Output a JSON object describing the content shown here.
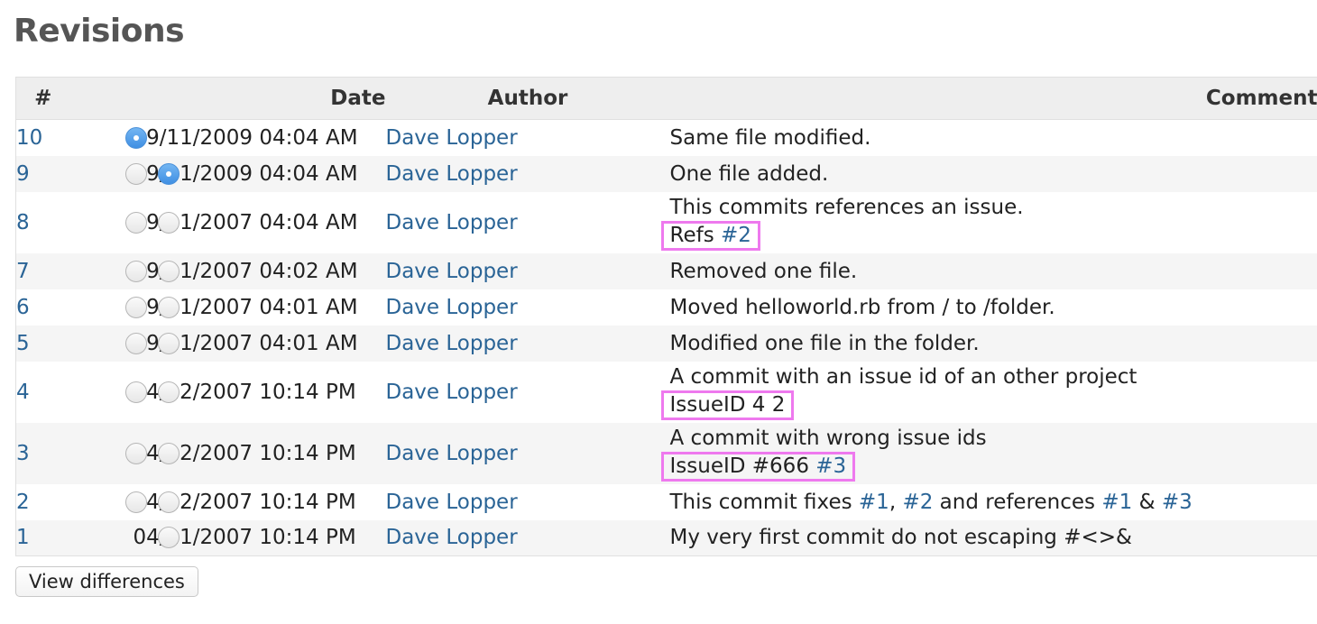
{
  "page": {
    "title": "Revisions"
  },
  "table": {
    "headers": {
      "num": "#",
      "date": "Date",
      "author": "Author",
      "comment": "Comment"
    },
    "rows": [
      {
        "rev": "10",
        "radio1": "checked",
        "radio2": "none",
        "date": "09/11/2009 04:04 AM",
        "author": "Dave Lopper",
        "comment": [
          {
            "t": "Same file modified."
          }
        ],
        "extra": null
      },
      {
        "rev": "9",
        "radio1": "unchecked",
        "radio2": "checked",
        "date": "09/11/2009 04:04 AM",
        "author": "Dave Lopper",
        "comment": [
          {
            "t": "One file added."
          }
        ],
        "extra": null
      },
      {
        "rev": "8",
        "radio1": "unchecked",
        "radio2": "unchecked",
        "date": "09/11/2007 04:04 AM",
        "author": "Dave Lopper",
        "comment": [
          {
            "t": "This commits references an issue."
          }
        ],
        "extra": [
          {
            "t": "Refs "
          },
          {
            "link": "#2"
          }
        ]
      },
      {
        "rev": "7",
        "radio1": "unchecked",
        "radio2": "unchecked",
        "date": "09/11/2007 04:02 AM",
        "author": "Dave Lopper",
        "comment": [
          {
            "t": "Removed one file."
          }
        ],
        "extra": null
      },
      {
        "rev": "6",
        "radio1": "unchecked",
        "radio2": "unchecked",
        "date": "09/11/2007 04:01 AM",
        "author": "Dave Lopper",
        "comment": [
          {
            "t": "Moved helloworld.rb from / to /folder."
          }
        ],
        "extra": null
      },
      {
        "rev": "5",
        "radio1": "unchecked",
        "radio2": "unchecked",
        "date": "09/11/2007 04:01 AM",
        "author": "Dave Lopper",
        "comment": [
          {
            "t": "Modified one file in the folder."
          }
        ],
        "extra": null
      },
      {
        "rev": "4",
        "radio1": "unchecked",
        "radio2": "unchecked",
        "date": "04/12/2007 10:14 PM",
        "author": "Dave Lopper",
        "comment": [
          {
            "t": "A commit with an issue id of an other project"
          }
        ],
        "extra": [
          {
            "t": "IssueID 4 2"
          }
        ]
      },
      {
        "rev": "3",
        "radio1": "unchecked",
        "radio2": "unchecked",
        "date": "04/12/2007 10:14 PM",
        "author": "Dave Lopper",
        "comment": [
          {
            "t": "A commit with wrong issue ids"
          }
        ],
        "extra": [
          {
            "t": "IssueID #666 "
          },
          {
            "link": "#3"
          }
        ]
      },
      {
        "rev": "2",
        "radio1": "unchecked",
        "radio2": "unchecked",
        "date": "04/12/2007 10:14 PM",
        "author": "Dave Lopper",
        "comment": [
          {
            "t": "This commit fixes "
          },
          {
            "link": "#1"
          },
          {
            "t": ", "
          },
          {
            "link": "#2"
          },
          {
            "t": " and references "
          },
          {
            "link": "#1"
          },
          {
            "t": " & "
          },
          {
            "link": "#3"
          }
        ],
        "extra": null
      },
      {
        "rev": "1",
        "radio1": "none",
        "radio2": "unchecked",
        "date": "04/11/2007 10:14 PM",
        "author": "Dave Lopper",
        "comment": [
          {
            "t": "My very first commit do not escaping #<>&"
          }
        ],
        "extra": null
      }
    ]
  },
  "actions": {
    "view_differences": "View differences"
  },
  "colors": {
    "link": "#2a6496",
    "highlight_border": "#ee79ee",
    "radio_checked": "#4a90d9"
  }
}
